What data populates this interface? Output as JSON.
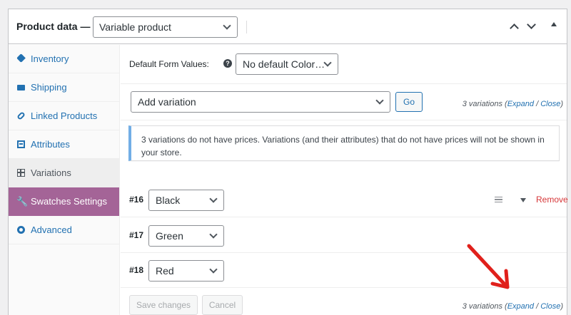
{
  "header": {
    "title": "Product data —",
    "product_type": "Variable product"
  },
  "sidebar": {
    "items": [
      {
        "label": "Inventory",
        "icon": "tag-icon"
      },
      {
        "label": "Shipping",
        "icon": "truck-icon"
      },
      {
        "label": "Linked Products",
        "icon": "link-icon"
      },
      {
        "label": "Attributes",
        "icon": "list-icon"
      },
      {
        "label": "Variations",
        "icon": "grid-icon"
      },
      {
        "label": "Swatches Settings",
        "icon": "wrench-icon"
      },
      {
        "label": "Advanced",
        "icon": "gear-icon"
      }
    ]
  },
  "main": {
    "default_form_label": "Default Form Values:",
    "help_glyph": "?",
    "default_form_value": "No default Color…",
    "add_variation": "Add variation",
    "go_label": "Go",
    "count_text": "3 variations",
    "expand_label": "Expand",
    "close_label": "Close",
    "notice": "3 variations do not have prices. Variations (and their attributes) that do not have prices will not be shown in your store.",
    "variations": [
      {
        "number": "#16",
        "value": "Black"
      },
      {
        "number": "#17",
        "value": "Green"
      },
      {
        "number": "#18",
        "value": "Red"
      }
    ],
    "remove_label": "Remove",
    "save_label": "Save changes",
    "cancel_label": "Cancel"
  },
  "colors": {
    "accent": "#2271b1",
    "swatches_active": "#a46497",
    "remove": "#d63638",
    "arrow": "#e0201b",
    "notice_border": "#72aee6"
  }
}
